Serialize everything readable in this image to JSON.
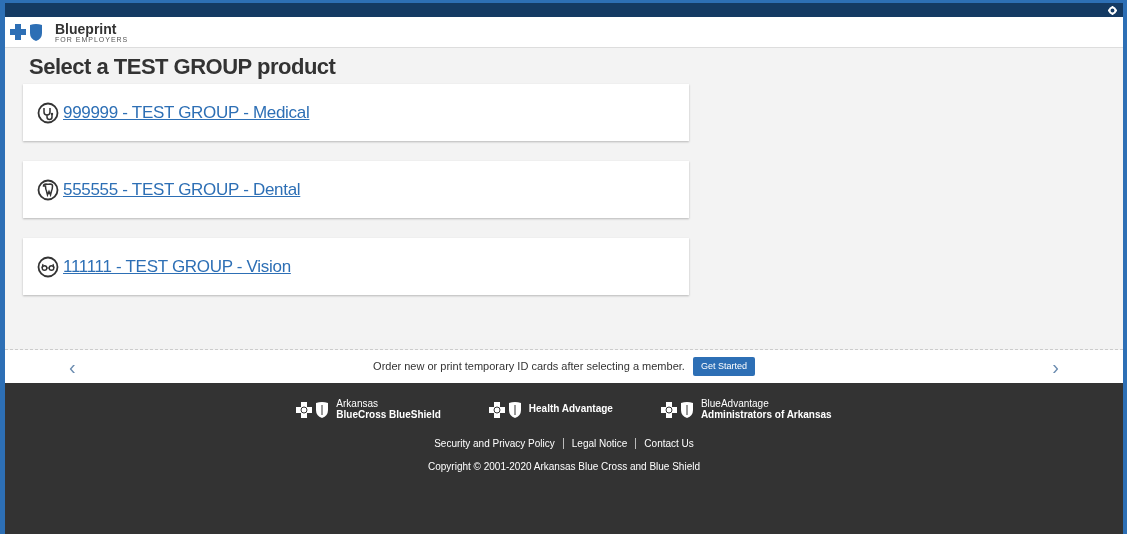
{
  "logo": {
    "name": "Blueprint",
    "tagline": "FOR EMPLOYERS"
  },
  "heading": "Select a TEST GROUP product",
  "products": [
    {
      "kind": "medical",
      "label": "999999 - TEST GROUP - Medical"
    },
    {
      "kind": "dental",
      "label": "555555 - TEST GROUP - Dental"
    },
    {
      "kind": "vision",
      "label": "111111 - TEST GROUP - Vision"
    }
  ],
  "promo": {
    "prev": "‹",
    "text": "Order new or print temporary ID cards after selecting a member.",
    "button": "Get Started",
    "next": "›"
  },
  "footer": {
    "brands": [
      {
        "line_1": "Arkansas",
        "line_2": "BlueCross BlueShield"
      },
      {
        "line_1": "Health Advantage"
      },
      {
        "line_1": "BlueAdvantage",
        "line_2": "Administrators of Arkansas"
      }
    ],
    "links": [
      "Security and Privacy Policy",
      "Legal Notice",
      "Contact Us"
    ],
    "copyright": "Copyright © 2001-2020 Arkansas Blue Cross and Blue Shield"
  }
}
